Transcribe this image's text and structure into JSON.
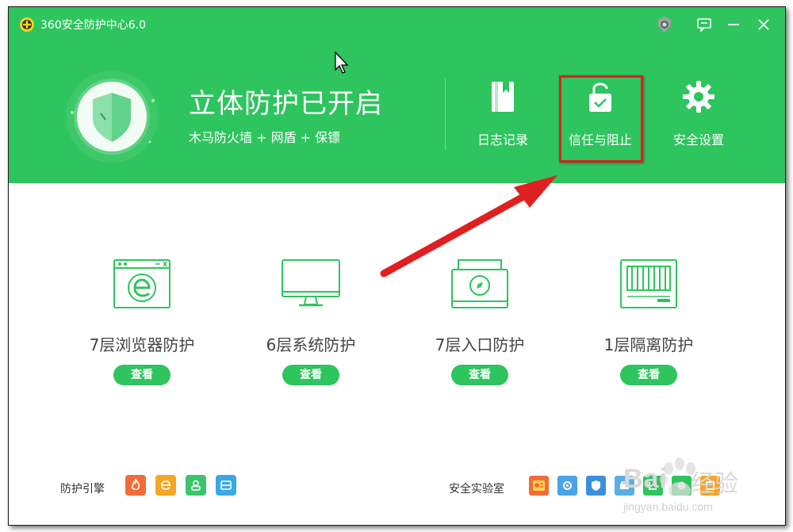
{
  "app": {
    "title": "360安全防护中心6.0"
  },
  "status": {
    "title": "立体防护已开启",
    "subtitle": "木马防火墙 + 网盾 + 保镖"
  },
  "toolbar": {
    "items": [
      {
        "label": "日志记录",
        "icon": "log-book-icon"
      },
      {
        "label": "信任与阻止",
        "icon": "lock-check-icon",
        "highlighted": true
      },
      {
        "label": "安全设置",
        "icon": "gear-icon"
      }
    ]
  },
  "features": [
    {
      "label": "7层浏览器防护",
      "button": "查看",
      "icon": "browser-icon"
    },
    {
      "label": "6层系统防护",
      "button": "查看",
      "icon": "monitor-icon"
    },
    {
      "label": "7层入口防护",
      "button": "查看",
      "icon": "compass-box-icon"
    },
    {
      "label": "1层隔离防护",
      "button": "查看",
      "icon": "isolation-icon"
    }
  ],
  "bottom": {
    "engine_label": "防护引擎",
    "engine_icons": [
      {
        "name": "engine-flame-icon",
        "color": "#f26b3a"
      },
      {
        "name": "engine-browser-icon",
        "color": "#f5a623"
      },
      {
        "name": "engine-user-icon",
        "color": "#3cc46d"
      },
      {
        "name": "engine-window-icon",
        "color": "#3aa7e8"
      }
    ],
    "lab_label": "安全实验室"
  },
  "watermark": {
    "text": "Bai",
    "text2": "经验",
    "url": "jingyan.baidu.com"
  },
  "colors": {
    "brand_green": "#2ec45e",
    "highlight_red": "#e02020"
  }
}
